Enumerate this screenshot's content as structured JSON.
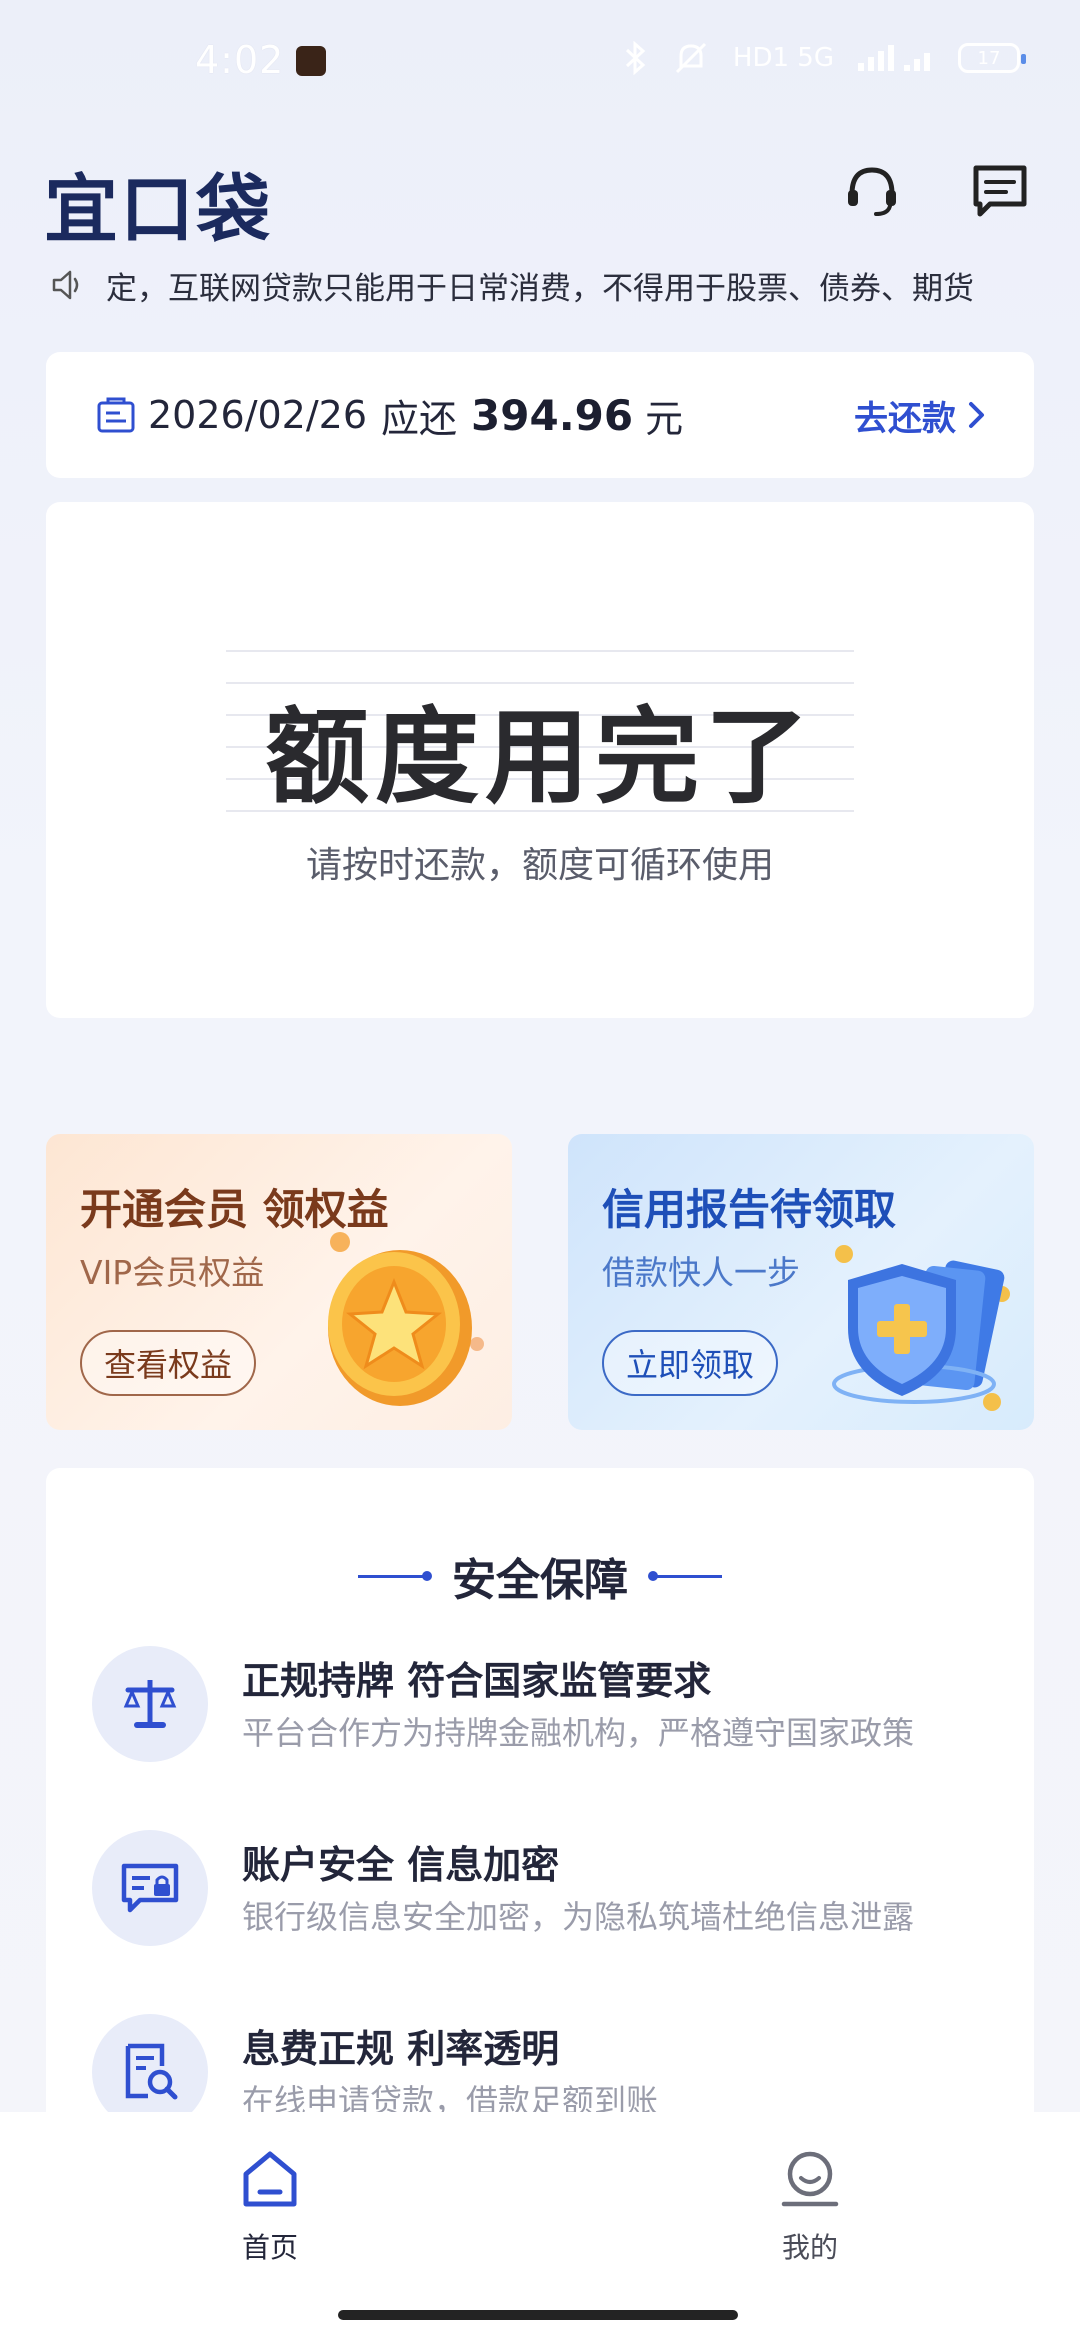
{
  "status_bar": {
    "time": "4:02",
    "right_text": "HD1 5G",
    "battery": "17"
  },
  "header": {
    "logo": "宜口袋",
    "icons": [
      "headset-icon",
      "message-icon"
    ]
  },
  "notice": {
    "icon": "speaker-icon",
    "text": "定，互联网贷款只能用于日常消费，不得用于股票、债券、期货"
  },
  "bill": {
    "icon": "bill-icon",
    "date": "2026/02/26",
    "due_label": "应还",
    "amount": "394.96",
    "unit": "元",
    "action": "去还款"
  },
  "quota": {
    "title": "额度用完了",
    "subtitle": "请按时还款，额度可循环使用"
  },
  "promos": [
    {
      "title": "开通会员 领权益",
      "subtitle": "VIP会员权益",
      "button": "查看权益",
      "icon": "star-coin-icon"
    },
    {
      "title": "信用报告待领取",
      "subtitle": "借款快人一步",
      "button": "立即领取",
      "icon": "shield-icon"
    }
  ],
  "security": {
    "title": "安全保障",
    "items": [
      {
        "icon": "scale-icon",
        "title": "正规持牌 符合国家监管要求",
        "desc": "平台合作方为持牌金融机构，严格遵守国家政策"
      },
      {
        "icon": "secure-message-icon",
        "title": "账户安全 信息加密",
        "desc": "银行级信息安全加密，为隐私筑墙杜绝信息泄露"
      },
      {
        "icon": "document-search-icon",
        "title": "息费正规  利率透明",
        "desc": "在线申请贷款，借款足额到账"
      }
    ]
  },
  "bottom_nav": [
    {
      "label": "首页",
      "icon": "home-icon",
      "active": true
    },
    {
      "label": "我的",
      "icon": "profile-icon",
      "active": false
    }
  ],
  "colors": {
    "accent": "#2f4fd0",
    "logo": "#1b2a5e"
  }
}
